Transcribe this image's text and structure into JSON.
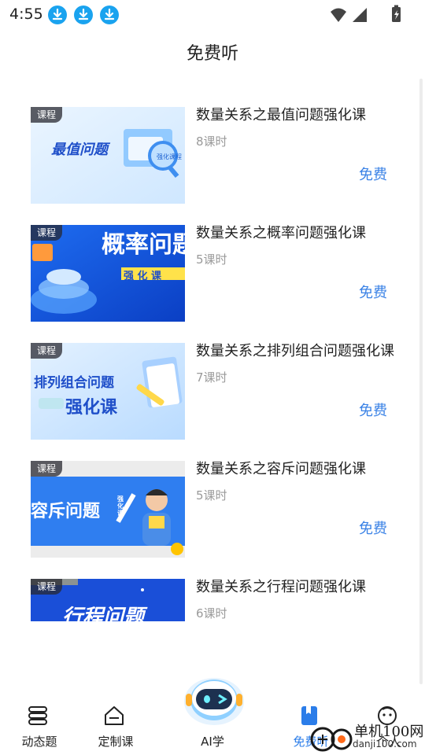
{
  "status": {
    "time": "4:55",
    "icons": [
      "download-icon",
      "download-icon",
      "download-icon",
      "wifi-icon",
      "signal-icon",
      "battery-icon"
    ]
  },
  "page": {
    "title": "免费听"
  },
  "courses": [
    {
      "badge": "课程",
      "title": "数量关系之最值问题强化课",
      "lessons": "8课时",
      "price": "免费",
      "thumb_text": "最值问题"
    },
    {
      "badge": "课程",
      "title": "数量关系之概率问题强化课",
      "lessons": "5课时",
      "price": "免费",
      "thumb_text": "概率问题"
    },
    {
      "badge": "课程",
      "title": "数量关系之排列组合问题强化课",
      "lessons": "7课时",
      "price": "免费",
      "thumb_text": "排列组合问题"
    },
    {
      "badge": "课程",
      "title": "数量关系之容斥问题强化课",
      "lessons": "5课时",
      "price": "免费",
      "thumb_text": "容斥问题"
    },
    {
      "badge": "课程",
      "title": "数量关系之行程问题强化课",
      "lessons": "6课时",
      "price": "免费",
      "thumb_text": "行程问题"
    }
  ],
  "thumb_extras": {
    "c1": "强化课程",
    "c2": "强 化 课",
    "c3": "强化课",
    "c4": "强化课"
  },
  "nav": [
    {
      "label": "动态题",
      "icon": "stack-icon",
      "active": false
    },
    {
      "label": "定制课",
      "icon": "home-icon",
      "active": false
    },
    {
      "label": "AI学",
      "icon": "robot-icon",
      "active": false
    },
    {
      "label": "免费听",
      "icon": "bookmark-icon",
      "active": true
    },
    {
      "label": "个人",
      "icon": "face-icon",
      "active": false
    }
  ],
  "watermark": {
    "text": "单机100网",
    "sub": "danji100.com"
  },
  "colors": {
    "accent": "#3a82e6",
    "nav_active": "#2b7de9",
    "download": "#1aa3ef"
  }
}
